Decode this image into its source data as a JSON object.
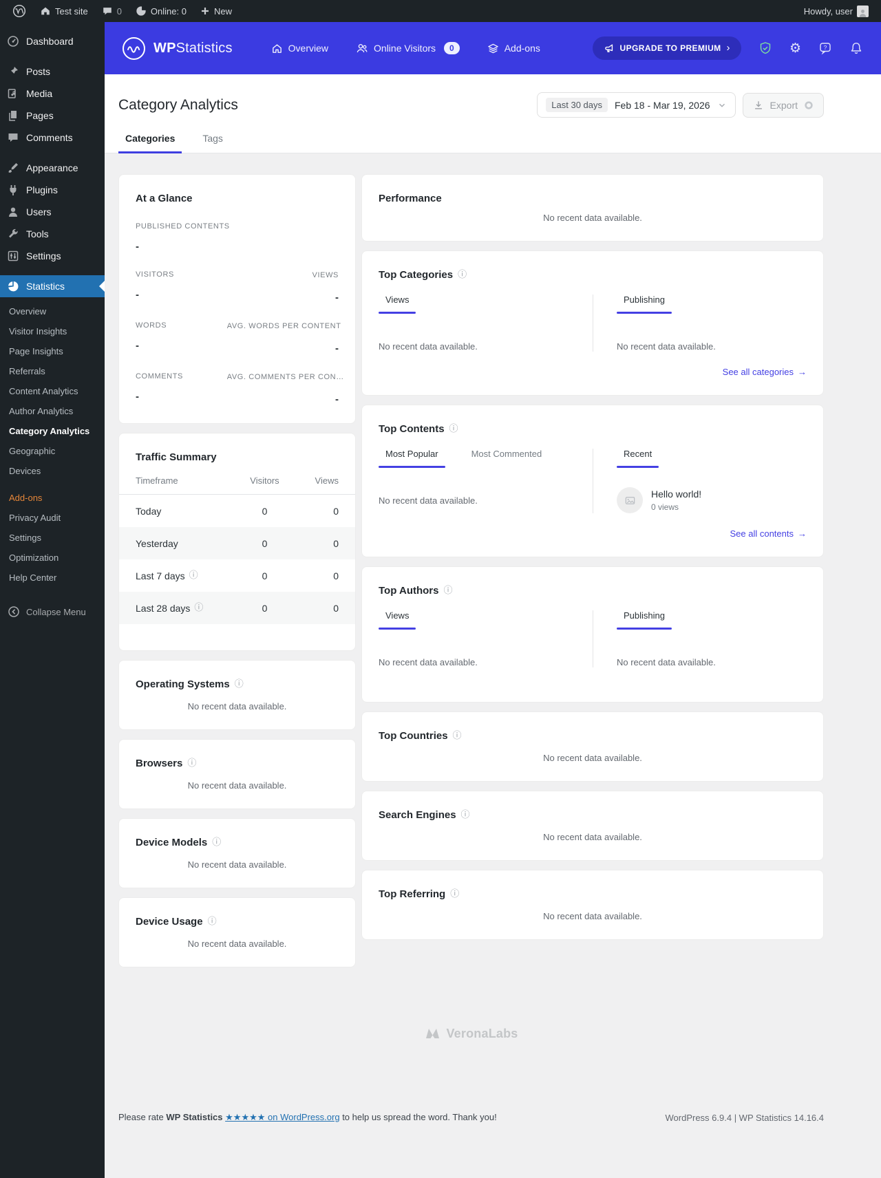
{
  "colors": {
    "accent": "#3B3BE1",
    "link": "#4440E3",
    "active_menu": "#2271b1",
    "sidebar_bg": "#1d2327",
    "orange": "#e68639"
  },
  "admin_bar": {
    "site_name": "Test site",
    "comment_count": "0",
    "online_label": "Online: 0",
    "new_label": "New",
    "howdy": "Howdy, user"
  },
  "wps_header": {
    "brand_primary": "WP",
    "brand_secondary": "Statistics",
    "nav": [
      {
        "label": "Overview"
      },
      {
        "label": "Online Visitors",
        "badge": "0"
      },
      {
        "label": "Add-ons"
      }
    ],
    "upgrade_label": "UPGRADE TO PREMIUM",
    "upgrade_chevron": "›"
  },
  "sidebar": {
    "items": [
      {
        "label": "Dashboard"
      },
      {
        "label": "Posts"
      },
      {
        "label": "Media"
      },
      {
        "label": "Pages"
      },
      {
        "label": "Comments"
      },
      {
        "label": "Appearance"
      },
      {
        "label": "Plugins"
      },
      {
        "label": "Users"
      },
      {
        "label": "Tools"
      },
      {
        "label": "Settings"
      },
      {
        "label": "Statistics"
      }
    ],
    "submenu": [
      {
        "label": "Overview"
      },
      {
        "label": "Visitor Insights"
      },
      {
        "label": "Page Insights"
      },
      {
        "label": "Referrals"
      },
      {
        "label": "Content Analytics"
      },
      {
        "label": "Author Analytics"
      },
      {
        "label": "Category Analytics"
      },
      {
        "label": "Geographic"
      },
      {
        "label": "Devices"
      },
      {
        "label": "Add-ons"
      },
      {
        "label": "Privacy Audit"
      },
      {
        "label": "Settings"
      },
      {
        "label": "Optimization"
      },
      {
        "label": "Help Center"
      }
    ],
    "collapse_label": "Collapse Menu"
  },
  "page": {
    "title": "Category Analytics",
    "tabs": [
      {
        "label": "Categories"
      },
      {
        "label": "Tags"
      }
    ],
    "date_preset": "Last 30 days",
    "date_range": "Feb 18 - Mar 19, 2026",
    "export_label": "Export"
  },
  "empty_message": "No recent data available.",
  "at_a_glance": {
    "title": "At a Glance",
    "metrics": [
      {
        "label": "Published contents",
        "value": "-"
      },
      {
        "label": "Visitors",
        "value": "-",
        "label2": "Views",
        "value2": "-"
      },
      {
        "label": "Words",
        "value": "-",
        "label2": "Avg. words per content",
        "value2": "-"
      },
      {
        "label": "Comments",
        "value": "-",
        "label2": "Avg. comments per con…",
        "value2": "-"
      }
    ]
  },
  "traffic_summary": {
    "title": "Traffic Summary",
    "columns": [
      "Timeframe",
      "Visitors",
      "Views"
    ],
    "rows": [
      {
        "timeframe": "Today",
        "visitors": "0",
        "views": "0"
      },
      {
        "timeframe": "Yesterday",
        "visitors": "0",
        "views": "0"
      },
      {
        "timeframe": "Last 7 days",
        "visitors": "0",
        "views": "0"
      },
      {
        "timeframe": "Last 28 days",
        "visitors": "0",
        "views": "0"
      }
    ]
  },
  "device_cards": [
    {
      "title": "Operating Systems"
    },
    {
      "title": "Browsers"
    },
    {
      "title": "Device Models"
    },
    {
      "title": "Device Usage"
    }
  ],
  "performance": {
    "title": "Performance"
  },
  "top_categories": {
    "title": "Top Categories",
    "left_tab": "Views",
    "right_tab": "Publishing",
    "see_all": "See all categories",
    "arrow": "→"
  },
  "top_contents": {
    "title": "Top Contents",
    "tab_popular": "Most Popular",
    "tab_commented": "Most Commented",
    "right_tab": "Recent",
    "recent_item": {
      "title": "Hello world!",
      "meta": "0 views"
    },
    "see_all": "See all contents",
    "arrow": "→"
  },
  "top_authors": {
    "title": "Top Authors",
    "left_tab": "Views",
    "right_tab": "Publishing"
  },
  "simple_cards": [
    {
      "title": "Top Countries"
    },
    {
      "title": "Search Engines"
    },
    {
      "title": "Top Referring"
    }
  ],
  "watermark": "VeronaLabs",
  "footer": {
    "rate_prefix": "Please rate",
    "plugin_name": "WP Statistics",
    "rate_link": "★★★★★ on WordPress.org",
    "rate_suffix": "to help us spread the word. Thank you!",
    "versions": "WordPress 6.9.4 | WP Statistics 14.16.4"
  }
}
